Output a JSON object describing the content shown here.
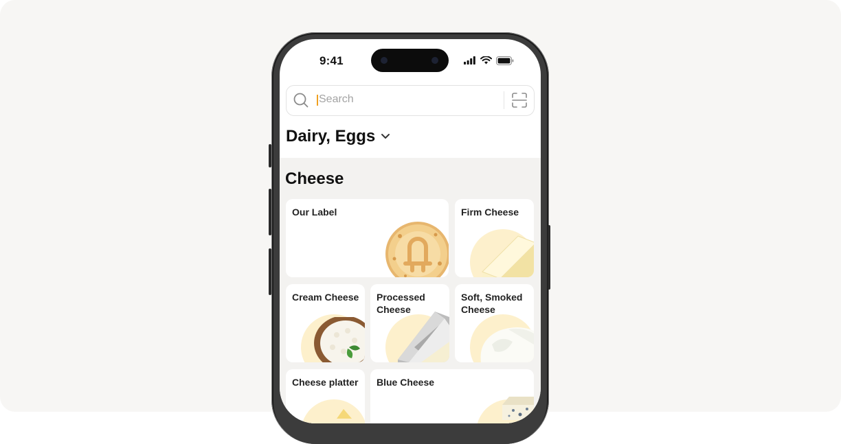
{
  "status_bar": {
    "time": "9:41"
  },
  "search": {
    "placeholder": "Search"
  },
  "category": {
    "title": "Dairy, Eggs"
  },
  "section": {
    "title": "Cheese"
  },
  "tiles": [
    {
      "label": "Our Label"
    },
    {
      "label": "Firm Cheese"
    },
    {
      "label": "Cream Cheese"
    },
    {
      "label": "Processed Cheese"
    },
    {
      "label": "Soft, Smoked Cheese"
    },
    {
      "label": "Cheese platter"
    },
    {
      "label": "Blue Cheese"
    }
  ],
  "colors": {
    "background": "#f7f6f4",
    "accent": "#f0a020",
    "tile_halo": "#fdf0cc"
  }
}
